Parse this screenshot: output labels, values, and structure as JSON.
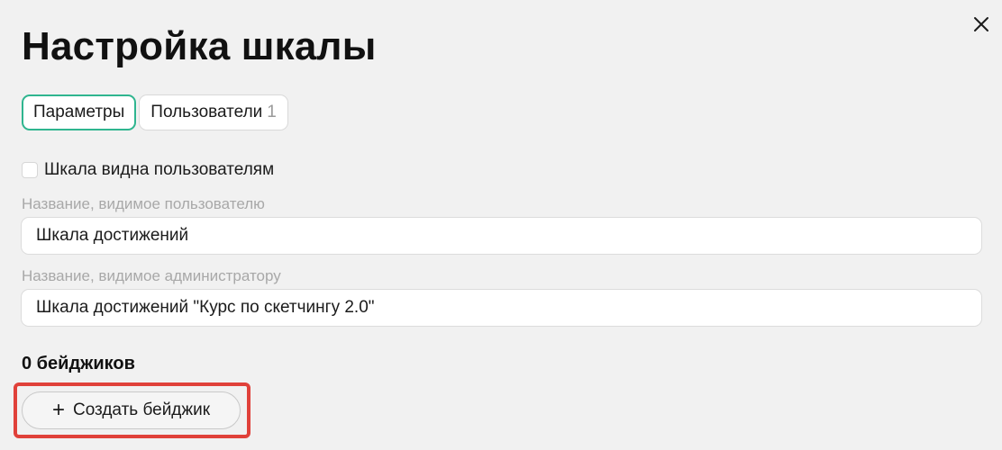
{
  "dialog": {
    "title": "Настройка шкалы",
    "close_icon": "close-icon"
  },
  "tabs": [
    {
      "label": "Параметры",
      "active": true
    },
    {
      "label": "Пользователи",
      "count": "1",
      "active": false
    }
  ],
  "visibility_checkbox": {
    "label": "Шкала видна пользователям",
    "checked": false
  },
  "fields": {
    "user_name": {
      "label": "Название, видимое пользователю",
      "value": "Шкала достижений"
    },
    "admin_name": {
      "label": "Название, видимое администратору",
      "value": "Шкала достижений \"Курс по скетчингу 2.0\""
    }
  },
  "badges": {
    "heading": "0 бейджиков",
    "create_button_label": "Создать бейджик",
    "create_button_icon": "plus-icon"
  },
  "colors": {
    "active_tab_border": "#2fb58f",
    "highlight_border": "#e0413a",
    "background": "#f1f1f1"
  }
}
